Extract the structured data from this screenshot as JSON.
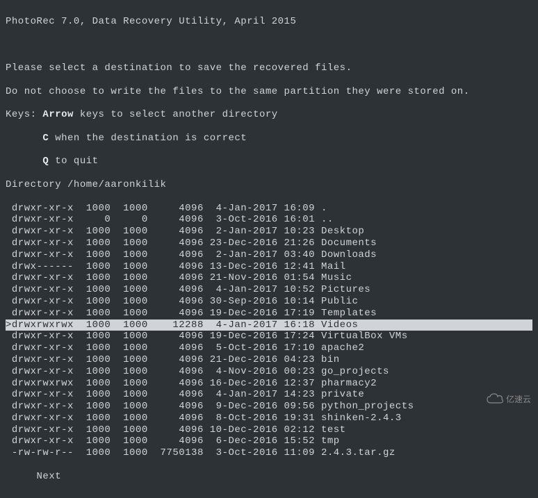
{
  "header": {
    "title": "PhotoRec 7.0, Data Recovery Utility, April 2015"
  },
  "instructions": {
    "line1": "Please select a destination to save the recovered files.",
    "line2": "Do not choose to write the files to the same partition they were stored on.",
    "keys_label": "Keys: ",
    "arrow_key": "Arrow",
    "arrow_desc": " keys to select another directory",
    "c_key": "C",
    "c_desc": " when the destination is correct",
    "q_key": "Q",
    "q_desc": " to quit"
  },
  "directory": {
    "label": "Directory ",
    "path": "/home/aaronkilik"
  },
  "selected_index": 10,
  "entries": [
    {
      "perms": " drwxr-xr-x",
      "uid": "1000",
      "gid": "1000",
      "size": "4096",
      "date": " 4-Jan-2017",
      "time": "16:09",
      "name": "."
    },
    {
      "perms": " drwxr-xr-x",
      "uid": "0",
      "gid": "0",
      "size": "4096",
      "date": " 3-Oct-2016",
      "time": "16:01",
      "name": ".."
    },
    {
      "perms": " drwxr-xr-x",
      "uid": "1000",
      "gid": "1000",
      "size": "4096",
      "date": " 2-Jan-2017",
      "time": "10:23",
      "name": "Desktop"
    },
    {
      "perms": " drwxr-xr-x",
      "uid": "1000",
      "gid": "1000",
      "size": "4096",
      "date": "23-Dec-2016",
      "time": "21:26",
      "name": "Documents"
    },
    {
      "perms": " drwxr-xr-x",
      "uid": "1000",
      "gid": "1000",
      "size": "4096",
      "date": " 2-Jan-2017",
      "time": "03:40",
      "name": "Downloads"
    },
    {
      "perms": " drwx------",
      "uid": "1000",
      "gid": "1000",
      "size": "4096",
      "date": "13-Dec-2016",
      "time": "12:41",
      "name": "Mail"
    },
    {
      "perms": " drwxr-xr-x",
      "uid": "1000",
      "gid": "1000",
      "size": "4096",
      "date": "21-Nov-2016",
      "time": "01:54",
      "name": "Music"
    },
    {
      "perms": " drwxr-xr-x",
      "uid": "1000",
      "gid": "1000",
      "size": "4096",
      "date": " 4-Jan-2017",
      "time": "10:52",
      "name": "Pictures"
    },
    {
      "perms": " drwxr-xr-x",
      "uid": "1000",
      "gid": "1000",
      "size": "4096",
      "date": "30-Sep-2016",
      "time": "10:14",
      "name": "Public"
    },
    {
      "perms": " drwxr-xr-x",
      "uid": "1000",
      "gid": "1000",
      "size": "4096",
      "date": "19-Dec-2016",
      "time": "17:19",
      "name": "Templates"
    },
    {
      "perms": ">drwxrwxrwx",
      "uid": "1000",
      "gid": "1000",
      "size": "12288",
      "date": " 4-Jan-2017",
      "time": "16:18",
      "name": "Videos"
    },
    {
      "perms": " drwxr-xr-x",
      "uid": "1000",
      "gid": "1000",
      "size": "4096",
      "date": "19-Dec-2016",
      "time": "17:24",
      "name": "VirtualBox VMs"
    },
    {
      "perms": " drwxr-xr-x",
      "uid": "1000",
      "gid": "1000",
      "size": "4096",
      "date": " 5-Oct-2016",
      "time": "17:10",
      "name": "apache2"
    },
    {
      "perms": " drwxr-xr-x",
      "uid": "1000",
      "gid": "1000",
      "size": "4096",
      "date": "21-Dec-2016",
      "time": "04:23",
      "name": "bin"
    },
    {
      "perms": " drwxr-xr-x",
      "uid": "1000",
      "gid": "1000",
      "size": "4096",
      "date": " 4-Nov-2016",
      "time": "00:23",
      "name": "go_projects"
    },
    {
      "perms": " drwxrwxrwx",
      "uid": "1000",
      "gid": "1000",
      "size": "4096",
      "date": "16-Dec-2016",
      "time": "12:37",
      "name": "pharmacy2"
    },
    {
      "perms": " drwxr-xr-x",
      "uid": "1000",
      "gid": "1000",
      "size": "4096",
      "date": " 4-Jan-2017",
      "time": "14:23",
      "name": "private"
    },
    {
      "perms": " drwxr-xr-x",
      "uid": "1000",
      "gid": "1000",
      "size": "4096",
      "date": " 9-Dec-2016",
      "time": "09:56",
      "name": "python_projects"
    },
    {
      "perms": " drwxr-xr-x",
      "uid": "1000",
      "gid": "1000",
      "size": "4096",
      "date": " 8-Oct-2016",
      "time": "19:31",
      "name": "shinken-2.4.3"
    },
    {
      "perms": " drwxr-xr-x",
      "uid": "1000",
      "gid": "1000",
      "size": "4096",
      "date": "10-Dec-2016",
      "time": "02:12",
      "name": "test"
    },
    {
      "perms": " drwxr-xr-x",
      "uid": "1000",
      "gid": "1000",
      "size": "4096",
      "date": " 6-Dec-2016",
      "time": "15:52",
      "name": "tmp"
    },
    {
      "perms": " -rw-rw-r--",
      "uid": "1000",
      "gid": "1000",
      "size": "7750138",
      "date": " 3-Oct-2016",
      "time": "11:09",
      "name": "2.4.3.tar.gz"
    }
  ],
  "footer": {
    "next": "Next"
  },
  "watermark": {
    "text": "亿速云"
  }
}
